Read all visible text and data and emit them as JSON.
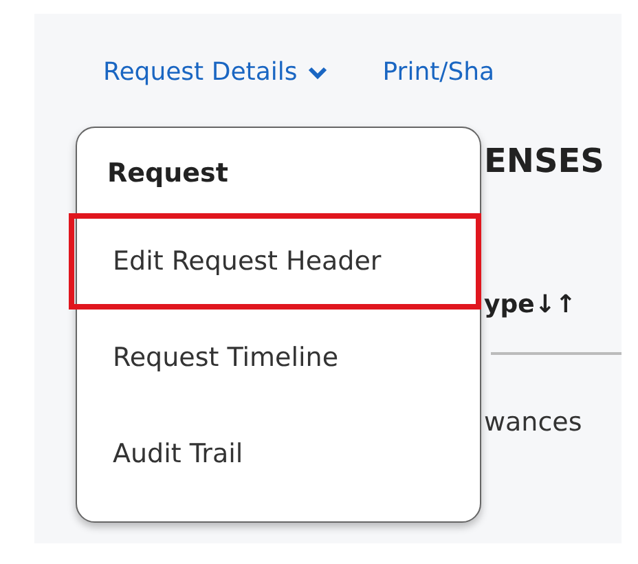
{
  "nav": {
    "items": [
      {
        "label": "Request Details",
        "kind": "dropdown"
      },
      {
        "label": "Print/Sha",
        "kind": "link"
      }
    ]
  },
  "page": {
    "heading": "ENSES",
    "column_header": "ype↓↑",
    "cell": "wances"
  },
  "menu": {
    "heading": "Request",
    "items": [
      {
        "label": "Edit Request Header",
        "highlighted": true
      },
      {
        "label": "Request Timeline",
        "highlighted": false
      },
      {
        "label": "Audit Trail",
        "highlighted": false
      }
    ]
  }
}
